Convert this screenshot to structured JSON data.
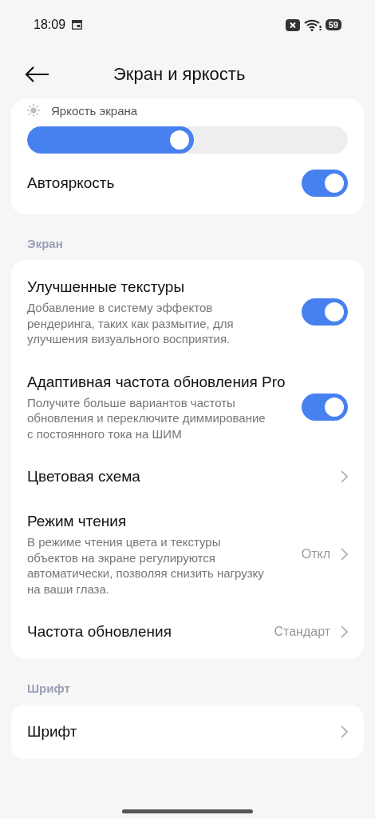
{
  "status_bar": {
    "time": "18:09",
    "battery": "59"
  },
  "header": {
    "title": "Экран и яркость"
  },
  "brightness": {
    "label": "Яркость экрана",
    "level": 0.5
  },
  "auto_brightness": {
    "label": "Автояркость",
    "on": true
  },
  "sections": [
    {
      "title": "Экран",
      "items": [
        {
          "kind": "toggle",
          "title": "Улучшенные текстуры",
          "description": "Добавление в систему эффектов рендеринга, таких как размытие, для улучшения визуального восприятия.",
          "on": true
        },
        {
          "kind": "toggle",
          "title": "Адаптивная частота обновления Pro",
          "description": "Получите больше вариантов частоты обновления и переключите диммирование с постоянного тока на ШИМ",
          "on": true
        },
        {
          "kind": "nav",
          "title": "Цветовая схема"
        },
        {
          "kind": "nav",
          "title": "Режим чтения",
          "description": "В режиме чтения цвета и текстуры объектов на экране регулируются автоматически, позволяя снизить нагрузку на ваши глаза.",
          "value": "Откл"
        },
        {
          "kind": "nav",
          "title": "Частота обновления",
          "value": "Стандарт"
        }
      ]
    },
    {
      "title": "Шрифт",
      "items": [
        {
          "kind": "nav",
          "title": "Шрифт"
        }
      ]
    }
  ]
}
